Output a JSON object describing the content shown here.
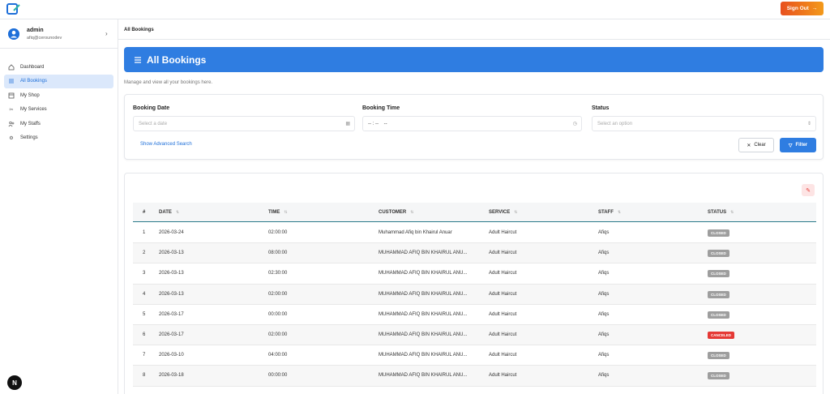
{
  "header": {
    "signout_label": "Sign Out"
  },
  "profile": {
    "name": "admin",
    "email": "afiq@cerounodev"
  },
  "sidebar": {
    "items": [
      {
        "label": "Dashboard",
        "icon": "home-icon"
      },
      {
        "label": "All Bookings",
        "icon": "list-icon",
        "active": true
      },
      {
        "label": "My Shop",
        "icon": "store-icon"
      },
      {
        "label": "My Services",
        "icon": "scissors-icon"
      },
      {
        "label": "My Staffs",
        "icon": "users-icon"
      },
      {
        "label": "Settings",
        "icon": "gear-icon"
      }
    ]
  },
  "breadcrumb": "All Bookings",
  "page": {
    "title": "All Bookings",
    "subtitle": "Manage and view all your bookings here."
  },
  "filters": {
    "booking_date": {
      "label": "Booking Date",
      "placeholder": "Select a date"
    },
    "booking_time": {
      "label": "Booking Time",
      "placeholder": "-- : --    --"
    },
    "status": {
      "label": "Status",
      "placeholder": "Select an option"
    },
    "advanced_link": "Show Advanced Search",
    "clear_label": "Clear",
    "filter_label": "Filter"
  },
  "table": {
    "columns": [
      "#",
      "DATE",
      "TIME",
      "CUSTOMER",
      "SERVICE",
      "STAFF",
      "STATUS"
    ],
    "rows": [
      {
        "num": "1",
        "date": "2026-03-24",
        "time": "02:00:00",
        "customer": "Muhammad Afiq bin Khairul Anuar",
        "service": "Adult Haircut",
        "staff": "Afiqs",
        "status": "CLOSED"
      },
      {
        "num": "2",
        "date": "2026-03-13",
        "time": "08:00:00",
        "customer": "MUHAMMAD AFIQ BIN KHAIRUL ANU...",
        "service": "Adult Haircut",
        "staff": "Afiqs",
        "status": "CLOSED"
      },
      {
        "num": "3",
        "date": "2026-03-13",
        "time": "02:30:00",
        "customer": "MUHAMMAD AFIQ BIN KHAIRUL ANU...",
        "service": "Adult Haircut",
        "staff": "Afiqs",
        "status": "CLOSED"
      },
      {
        "num": "4",
        "date": "2026-03-13",
        "time": "02:00:00",
        "customer": "MUHAMMAD AFIQ BIN KHAIRUL ANU...",
        "service": "Adult Haircut",
        "staff": "Afiqs",
        "status": "CLOSED"
      },
      {
        "num": "5",
        "date": "2026-03-17",
        "time": "00:00:00",
        "customer": "MUHAMMAD AFIQ BIN KHAIRUL ANU...",
        "service": "Adult Haircut",
        "staff": "Afiqs",
        "status": "CLOSED"
      },
      {
        "num": "6",
        "date": "2026-03-17",
        "time": "02:00:00",
        "customer": "MUHAMMAD AFIQ BIN KHAIRUL ANU...",
        "service": "Adult Haircut",
        "staff": "Afiqs",
        "status": "CANCELED"
      },
      {
        "num": "7",
        "date": "2026-03-10",
        "time": "04:00:00",
        "customer": "MUHAMMAD AFIQ BIN KHAIRUL ANU...",
        "service": "Adult Haircut",
        "staff": "Afiqs",
        "status": "CLOSED"
      },
      {
        "num": "8",
        "date": "2026-03-18",
        "time": "00:00:00",
        "customer": "MUHAMMAD AFIQ BIN KHAIRUL ANU...",
        "service": "Adult Haircut",
        "staff": "Afiqs",
        "status": "CLOSED"
      }
    ]
  },
  "colors": {
    "accent": "#2f7de1",
    "status_closed": "#9e9e9e",
    "status_canceled": "#e53935",
    "signout_gradient_start": "#e8501e",
    "signout_gradient_end": "#f39a1b"
  }
}
